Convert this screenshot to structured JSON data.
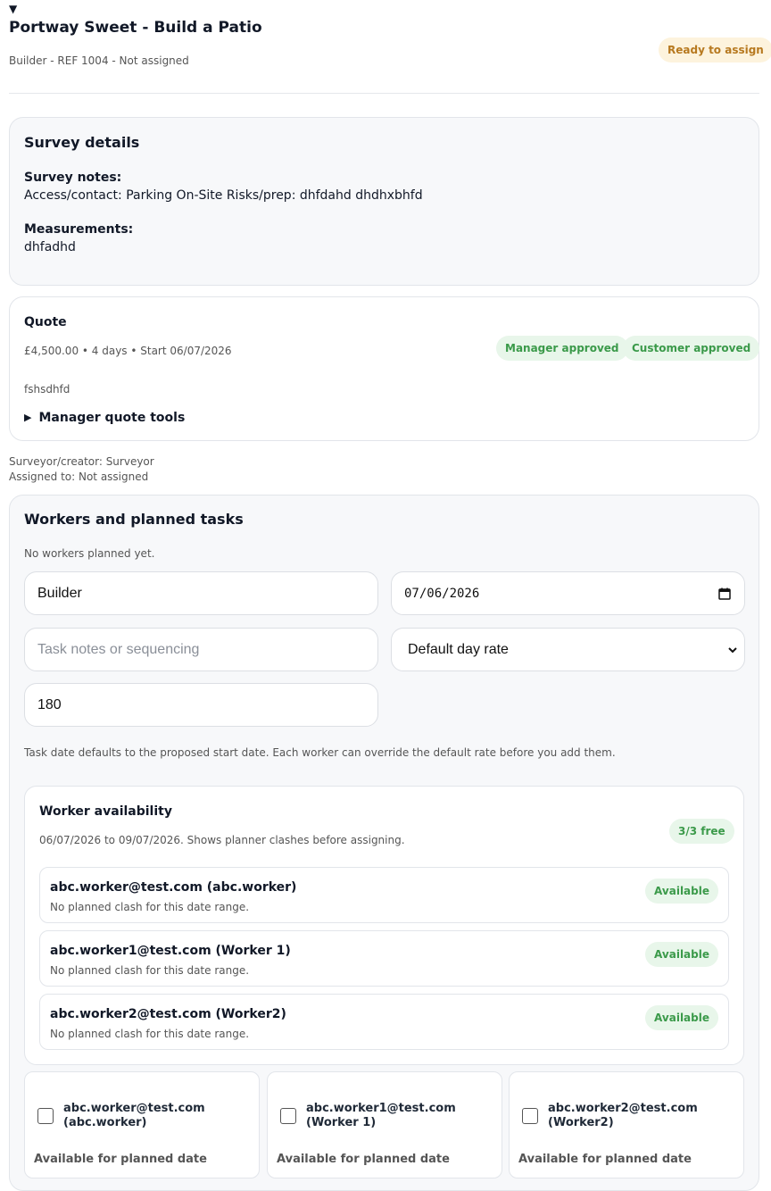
{
  "job": {
    "caret": "▼",
    "title": "Portway Sweet - Build a Patio",
    "subtitle": "Builder - REF 1004 - Not assigned",
    "status": "Ready to assign"
  },
  "survey": {
    "heading": "Survey details",
    "notes_label": "Survey notes:",
    "notes_value": "Access/contact: Parking On-Site Risks/prep: dhfdahd dhdhxbhfd",
    "measurements_label": "Measurements:",
    "measurements_value": "dhfadhd"
  },
  "quote": {
    "heading": "Quote",
    "summary": "£4,500.00 • 4 days • Start 06/07/2026",
    "badges": [
      "Manager approved",
      "Customer approved"
    ],
    "note": "fshsdhfd",
    "tools_caret": "▶",
    "tools_label": "Manager quote tools"
  },
  "assignment": {
    "surveyor": "Surveyor/creator: Surveyor",
    "assigned": "Assigned to: Not assigned"
  },
  "workers_section": {
    "heading": "Workers and planned tasks",
    "empty_text": "No workers planned yet.",
    "role_value": "Builder",
    "date_value": "07/06/2026",
    "task_notes_placeholder": "Task notes or sequencing",
    "rate_select_value": "Default day rate",
    "rate_value": "180",
    "help_text": "Task date defaults to the proposed start date. Each worker can override the default rate before you add them."
  },
  "availability": {
    "heading": "Worker availability",
    "range_text": "06/07/2026 to 09/07/2026. Shows planner clashes before assigning.",
    "free_badge": "3/3 free",
    "workers": [
      {
        "name": "abc.worker@test.com (abc.worker)",
        "note": "No planned clash for this date range.",
        "status": "Available"
      },
      {
        "name": "abc.worker1@test.com (Worker 1)",
        "note": "No planned clash for this date range.",
        "status": "Available"
      },
      {
        "name": "abc.worker2@test.com (Worker2)",
        "note": "No planned clash for this date range.",
        "status": "Available"
      }
    ]
  },
  "worker_picks": [
    {
      "name": "abc.worker@test.com (abc.worker)",
      "status": "Available for planned date"
    },
    {
      "name": "abc.worker1@test.com (Worker 1)",
      "status": "Available for planned date"
    },
    {
      "name": "abc.worker2@test.com (Worker2)",
      "status": "Available for planned date"
    }
  ],
  "icons": {
    "calendar": "calendar-icon",
    "chevron": "chevron-down-icon"
  },
  "colors": {
    "amber_text": "#b7791f",
    "amber_bg": "#fdf3dd",
    "green_text": "#3b9a4a",
    "green_bg": "#e8f6ea",
    "card_grey": "#f7f8fa"
  }
}
